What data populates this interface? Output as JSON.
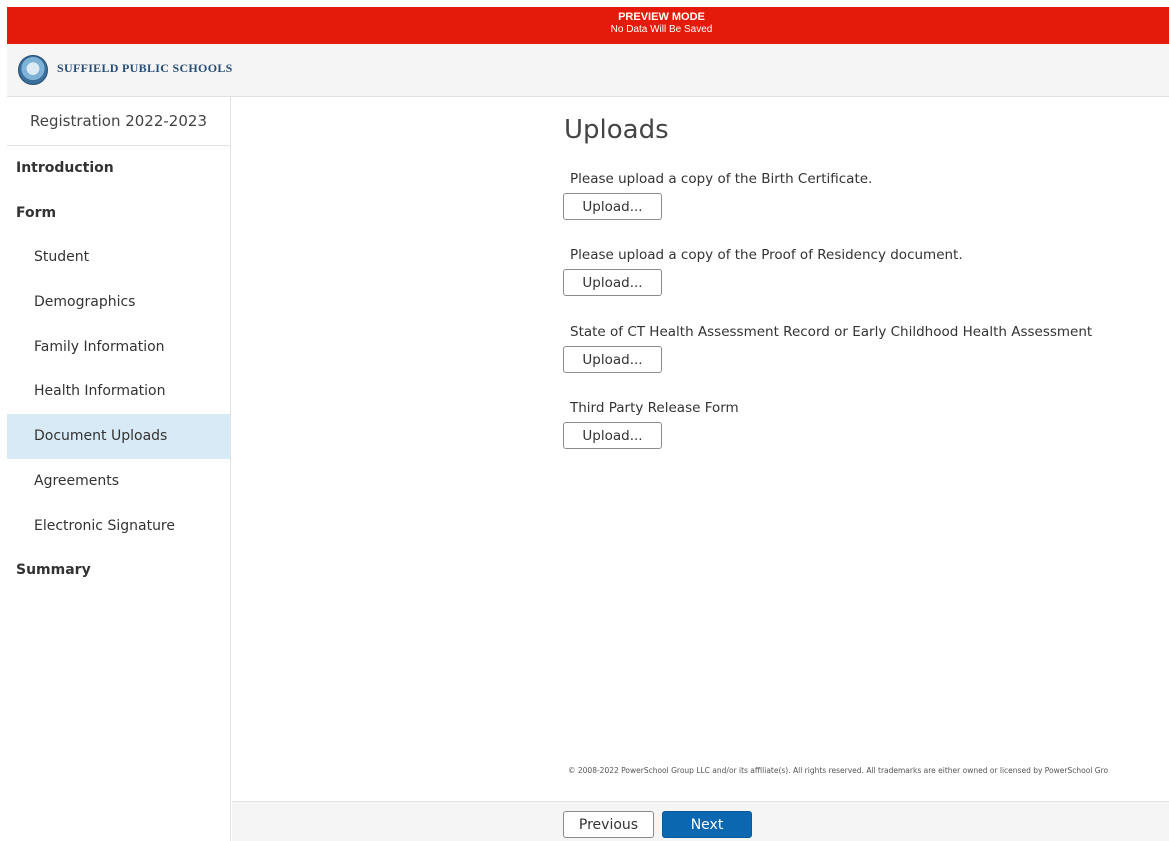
{
  "preview": {
    "title": "PREVIEW MODE",
    "subtitle": "No Data Will Be Saved"
  },
  "header": {
    "school_name": "SUFFIELD PUBLIC SCHOOLS"
  },
  "sidebar": {
    "title": "Registration 2022-2023",
    "items": [
      {
        "label": "Introduction",
        "level": "section"
      },
      {
        "label": "Form",
        "level": "section"
      },
      {
        "label": "Student",
        "level": "sub"
      },
      {
        "label": "Demographics",
        "level": "sub"
      },
      {
        "label": "Family Information",
        "level": "sub"
      },
      {
        "label": "Health Information",
        "level": "sub"
      },
      {
        "label": "Document Uploads",
        "level": "sub",
        "active": true
      },
      {
        "label": "Agreements",
        "level": "sub"
      },
      {
        "label": "Electronic Signature",
        "level": "sub"
      },
      {
        "label": "Summary",
        "level": "section"
      }
    ]
  },
  "main": {
    "title": "Uploads",
    "uploads": [
      {
        "label": "Please upload a copy of the Birth Certificate.",
        "button": "Upload..."
      },
      {
        "label": "Please upload a copy of the Proof of Residency document.",
        "button": "Upload..."
      },
      {
        "label": "State of CT Health Assessment Record or Early Childhood Health Assessment",
        "button": "Upload..."
      },
      {
        "label": "Third Party Release Form",
        "button": "Upload..."
      }
    ],
    "copyright": "© 2008-2022 PowerSchool Group LLC and/or its affiliate(s). All rights reserved. All trademarks are either owned or licensed by PowerSchool Gro"
  },
  "footer": {
    "previous_label": "Previous",
    "next_label": "Next"
  },
  "colors": {
    "banner": "#e41b0a",
    "active_nav": "#d7eaf5",
    "next_button": "#0a67b0",
    "school_name": "#274e76"
  }
}
